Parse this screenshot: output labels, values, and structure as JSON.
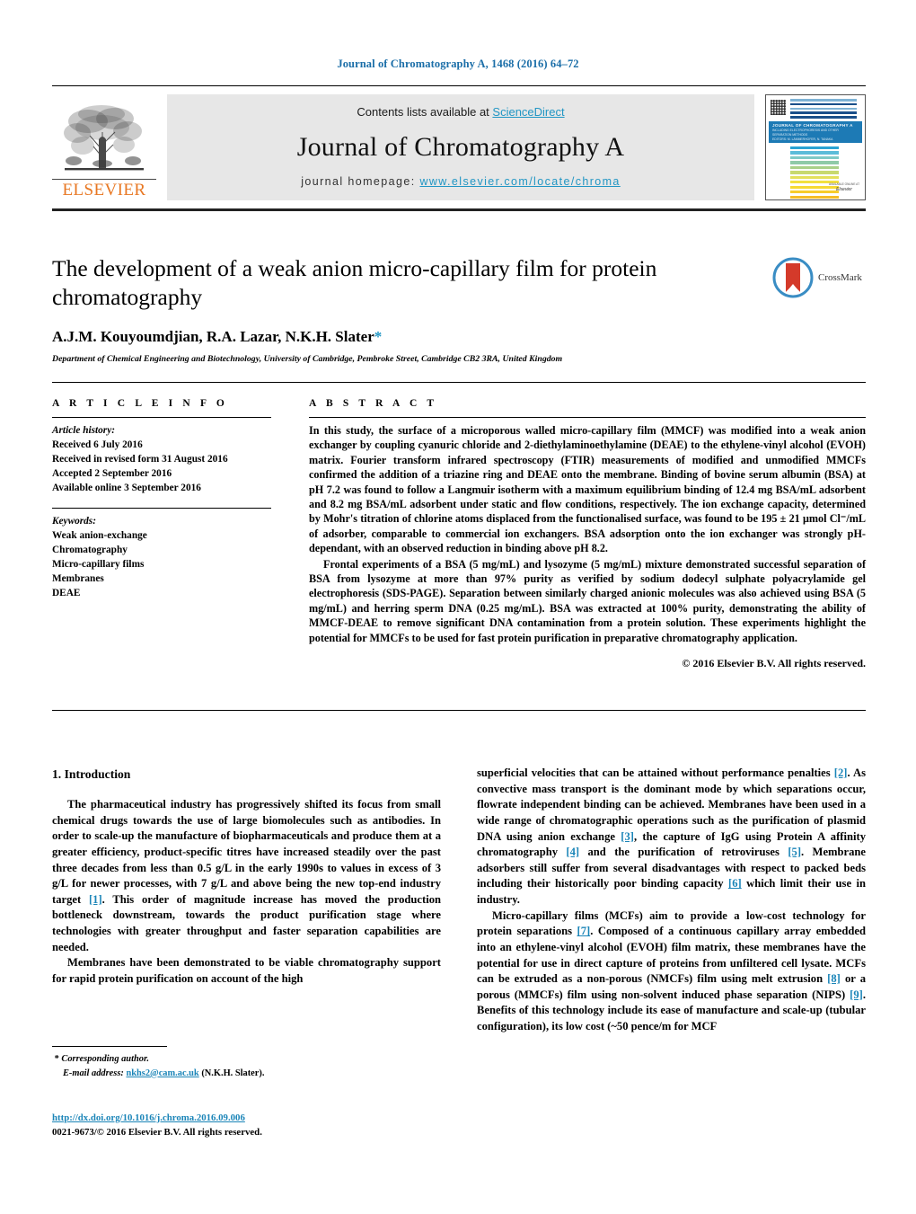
{
  "running_head": "Journal of Chromatography A, 1468 (2016) 64–72",
  "masthead": {
    "contents_prefix": "Contents lists available at ",
    "sciencedirect": "ScienceDirect",
    "journal_title": "Journal of Chromatography A",
    "homepage_prefix": "journal homepage: ",
    "homepage_url": "www.elsevier.com/locate/chroma",
    "publisher_logo_text": "ELSEVIER",
    "cover": {
      "banner_title": "JOURNAL OF CHROMATOGRAPHY A",
      "banner_sub1": "INCLUDING ELECTROPHORESIS AND OTHER SEPARATION METHODS",
      "banner_sub2": "EDITORS: M. LÄMMERHOFER, N. TANAKA",
      "footer_brand": "Elsevier",
      "footer_sub": "AVAILABLE ONLINE AT"
    },
    "accent_blue": "#2196c4",
    "accent_orange": "#E87722"
  },
  "article": {
    "title": "The development of a weak anion micro-capillary film for protein chromatography",
    "authors": "A.J.M. Kouyoumdjian, R.A. Lazar, N.K.H. Slater",
    "corresponding_marker": "*",
    "affiliation": "Department of Chemical Engineering and Biotechnology, University of Cambridge, Pembroke Street, Cambridge CB2 3RA, United Kingdom",
    "crossmark_label": "CrossMark"
  },
  "article_info": {
    "heading": "A R T I C L E    I N F O",
    "history_label": "Article history:",
    "history": [
      "Received 6 July 2016",
      "Received in revised form 31 August 2016",
      "Accepted 2 September 2016",
      "Available online 3 September 2016"
    ],
    "keywords_label": "Keywords:",
    "keywords": [
      "Weak anion-exchange",
      "Chromatography",
      "Micro-capillary films",
      "Membranes",
      "DEAE"
    ]
  },
  "abstract": {
    "heading": "A B S T R A C T",
    "paragraph1": "In this study, the surface of a microporous walled micro-capillary film (MMCF) was modified into a weak anion exchanger by coupling cyanuric chloride and 2-diethylaminoethylamine (DEAE) to the ethylene-vinyl alcohol (EVOH) matrix. Fourier transform infrared spectroscopy (FTIR) measurements of modified and unmodified MMCFs confirmed the addition of a triazine ring and DEAE onto the membrane. Binding of bovine serum albumin (BSA) at pH 7.2 was found to follow a Langmuir isotherm with a maximum equilibrium binding of 12.4 mg BSA/mL adsorbent and 8.2 mg BSA/mL adsorbent under static and flow conditions, respectively. The ion exchange capacity, determined by Mohr's titration of chlorine atoms displaced from the functionalised surface, was found to be 195 ± 21 μmol Cl⁻/mL of adsorber, comparable to commercial ion exchangers. BSA adsorption onto the ion exchanger was strongly pH-dependant, with an observed reduction in binding above pH 8.2.",
    "paragraph2": "Frontal experiments of a BSA (5 mg/mL) and lysozyme (5 mg/mL) mixture demonstrated successful separation of BSA from lysozyme at more than 97% purity as verified by sodium dodecyl sulphate polyacrylamide gel electrophoresis (SDS-PAGE). Separation between similarly charged anionic molecules was also achieved using BSA (5 mg/mL) and herring sperm DNA (0.25 mg/mL). BSA was extracted at 100% purity, demonstrating the ability of MMCF-DEAE to remove significant DNA contamination from a protein solution. These experiments highlight the potential for MMCFs to be used for fast protein purification in preparative chromatography application.",
    "copyright": "© 2016 Elsevier B.V. All rights reserved."
  },
  "introduction": {
    "heading": "1.  Introduction",
    "left_p1": "The pharmaceutical industry has progressively shifted its focus from small chemical drugs towards the use of large biomolecules such as antibodies. In order to scale-up the manufacture of biopharmaceuticals and produce them at a greater efficiency, product-specific titres have increased steadily over the past three decades from less than 0.5 g/L in the early 1990s to values in excess of 3 g/L for newer processes, with 7 g/L and above being the new top-end industry target ",
    "left_p1_ref": "[1]",
    "left_p1_cont": ". This order of magnitude increase has moved the production bottleneck downstream, towards the product purification stage where technologies with greater throughput and faster separation capabilities are needed.",
    "left_p2": "Membranes have been demonstrated to be viable chromatography support for rapid protein purification on account of the high",
    "right_p1_a": "superficial velocities that can be attained without performance penalties ",
    "right_ref2": "[2]",
    "right_p1_b": ". As convective mass transport is the dominant mode by which separations occur, flowrate independent binding can be achieved. Membranes have been used in a wide range of chromatographic operations such as the purification of plasmid DNA using anion exchange ",
    "right_ref3": "[3]",
    "right_p1_c": ", the capture of IgG using Protein A affinity chromatography ",
    "right_ref4": "[4]",
    "right_p1_d": " and the purification of retroviruses ",
    "right_ref5": "[5]",
    "right_p1_e": ". Membrane adsorbers still suffer from several disadvantages with respect to packed beds including their historically poor binding capacity ",
    "right_ref6": "[6]",
    "right_p1_f": " which limit their use in industry.",
    "right_p2_a": "Micro-capillary films (MCFs) aim to provide a low-cost technology for protein separations ",
    "right_ref7": "[7]",
    "right_p2_b": ". Composed of a continuous capillary array embedded into an ethylene-vinyl alcohol (EVOH) film matrix, these membranes have the potential for use in direct capture of proteins from unfiltered cell lysate. MCFs can be extruded as a non-porous (NMCFs) film using melt extrusion ",
    "right_ref8": "[8]",
    "right_p2_c": " or a porous (MMCFs) film using non-solvent induced phase separation (NIPS) ",
    "right_ref9": "[9]",
    "right_p2_d": ". Benefits of this technology include its ease of manufacture and scale-up (tubular configuration), its low cost (~50 pence/m for MCF"
  },
  "footnote": {
    "corresponding_marker": "*",
    "corresponding_label": "Corresponding author.",
    "email_label": "E-mail address:",
    "email": "nkhs2@cam.ac.uk",
    "email_owner": "(N.K.H. Slater)."
  },
  "footer": {
    "doi": "http://dx.doi.org/10.1016/j.chroma.2016.09.006",
    "issn_line": "0021-9673/© 2016 Elsevier B.V. All rights reserved."
  }
}
